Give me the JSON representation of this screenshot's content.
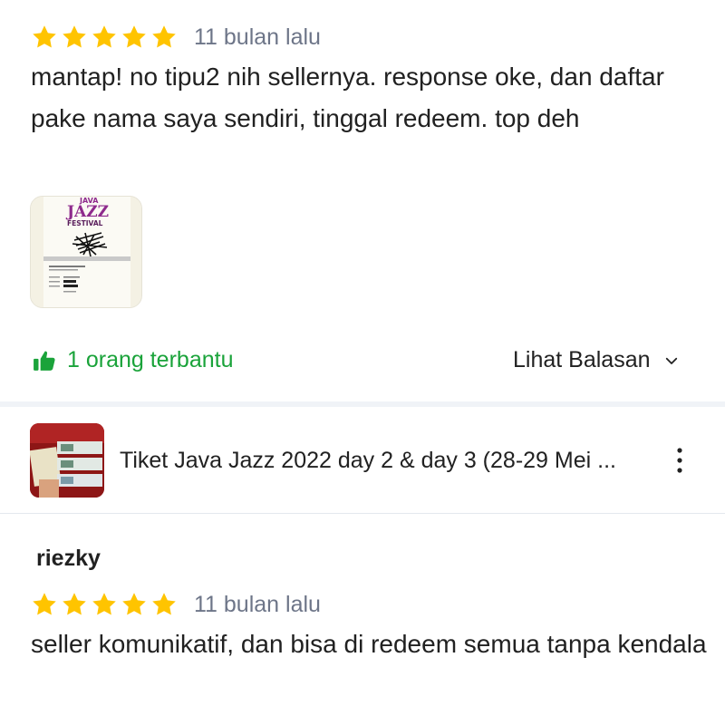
{
  "review1": {
    "rating": 5,
    "time": "11 bulan lalu",
    "text": "mantap! no tipu2 nih sellernya. response oke, dan daftar pake nama saya sendiri, tinggal redeem. top deh",
    "photo": {
      "logo_line1": "JAVA",
      "logo_line2": "JAZZ",
      "logo_line3": "FESTIVAL"
    },
    "helpful_text": "1 orang terbantu",
    "replies_label": "Lihat Balasan"
  },
  "product": {
    "title": "Tiket Java Jazz 2022 day 2 & day 3 (28-29 Mei ..."
  },
  "review2": {
    "username": "riezky",
    "rating": 5,
    "time": "11 bulan lalu",
    "text": "seller komunikatif, dan bisa di redeem semua tanpa kendala"
  },
  "icons": {
    "star": "star-icon",
    "thumbs_up": "thumbs-up-icon",
    "chevron": "chevron-down-icon",
    "more": "more-vertical-icon"
  },
  "colors": {
    "star": "#ffc400",
    "helpful": "#1aa33a",
    "muted": "#6d7588"
  }
}
